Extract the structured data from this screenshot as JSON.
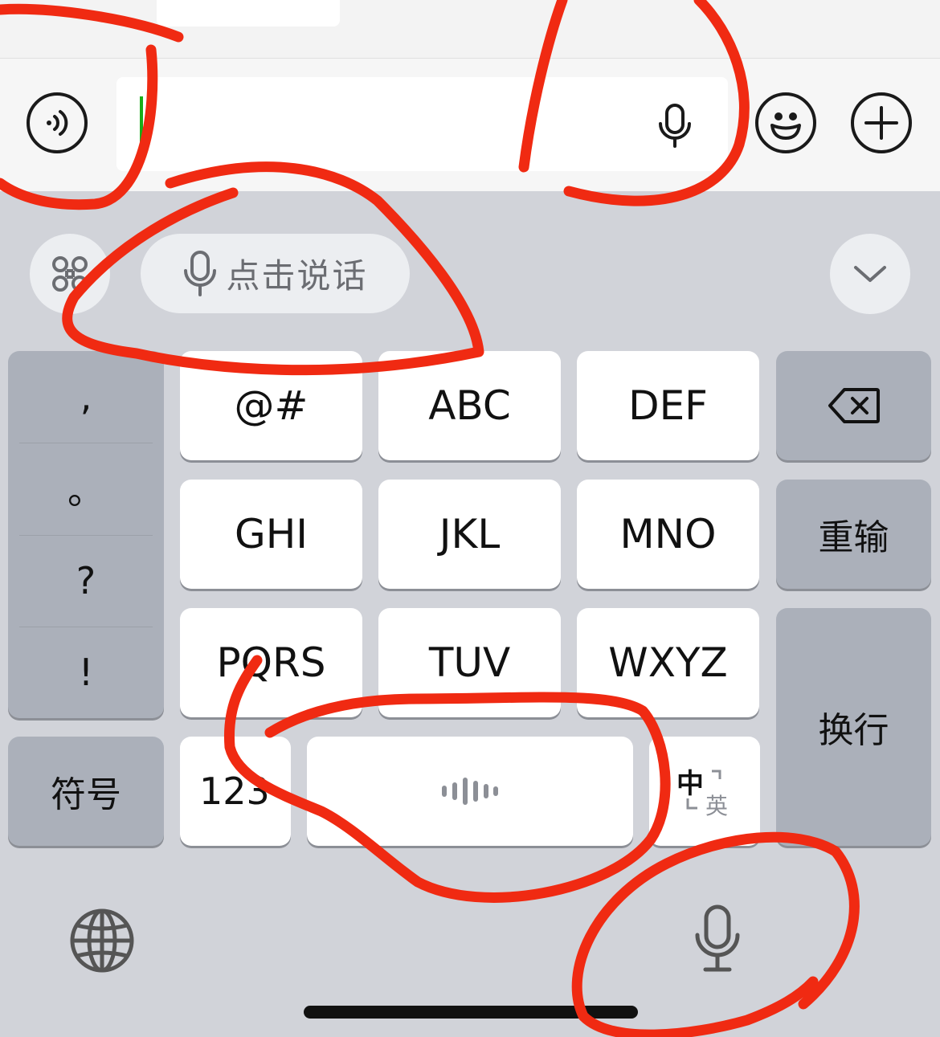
{
  "colors": {
    "annotation": "#f02a12",
    "caret": "#1aad19",
    "keyboard_bg": "#d1d3d9",
    "dark_key": "#abb0ba",
    "light_key": "#ffffff"
  },
  "input_bar": {
    "left_icon": "voice-mode-icon",
    "text_value": "",
    "inner_icon": "microphone-icon",
    "right_icons": [
      "emoji-icon",
      "plus-icon"
    ]
  },
  "toolbar": {
    "menu_icon": "command-grid-icon",
    "speak_button_label": "点击说话",
    "collapse_icon": "chevron-down-icon"
  },
  "keyboard": {
    "punctuation": [
      ",",
      "。",
      "?",
      "!"
    ],
    "symbol_key": "符号",
    "rows": [
      [
        "@#",
        "ABC",
        "DEF"
      ],
      [
        "GHI",
        "JKL",
        "MNO"
      ],
      [
        "PQRS",
        "TUV",
        "WXYZ"
      ]
    ],
    "backspace_icon": "backspace-icon",
    "retype_key": "重输",
    "return_key": "换行",
    "numbers_key": "123",
    "space_icon": "voice-waveform-icon",
    "lang_zh": "中",
    "lang_en": "英"
  },
  "bottom_bar": {
    "globe_icon": "globe-icon",
    "dictation_icon": "microphone-icon"
  }
}
